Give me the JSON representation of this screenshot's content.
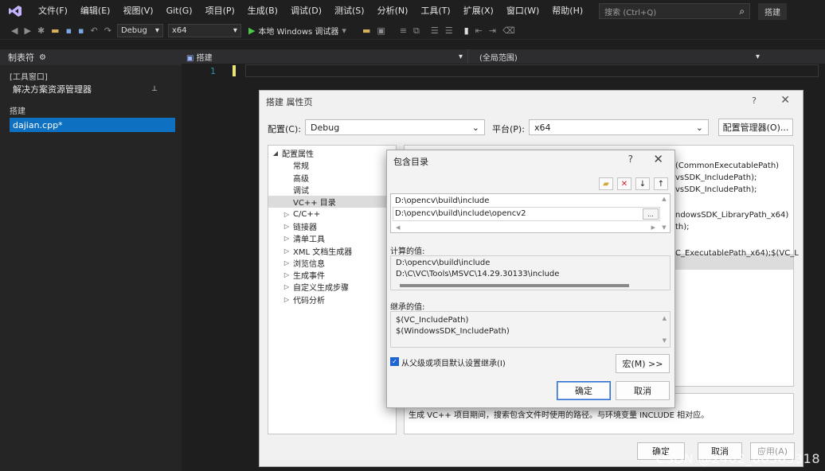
{
  "menubar": {
    "items": [
      "文件(F)",
      "编辑(E)",
      "视图(V)",
      "Git(G)",
      "项目(P)",
      "生成(B)",
      "调试(D)",
      "测试(S)",
      "分析(N)",
      "工具(T)",
      "扩展(X)",
      "窗口(W)",
      "帮助(H)"
    ],
    "search_placeholder": "搜索 (Ctrl+Q)",
    "project_name": "搭建"
  },
  "toolbar": {
    "config": "Debug",
    "platform": "x64",
    "debugger": "本地 Windows 调试器"
  },
  "left_panel": {
    "title": "制表符",
    "section1": "[工具窗口]",
    "solution_explorer": "解决方案资源管理器",
    "section2": "搭建",
    "file": "dajian.cpp*"
  },
  "editor": {
    "tab_file": "搭建",
    "scope": "(全局范围)",
    "line_number": "1"
  },
  "property_dialog": {
    "title": "搭建 属性页",
    "help": "?",
    "config_label": "配置(C):",
    "config_value": "Debug",
    "platform_label": "平台(P):",
    "platform_value": "x64",
    "config_manager": "配置管理器(O)...",
    "tree": [
      {
        "label": "配置属性",
        "expander": "◢",
        "indent": 0
      },
      {
        "label": "常规",
        "expander": "",
        "indent": 1
      },
      {
        "label": "高级",
        "expander": "",
        "indent": 1
      },
      {
        "label": "调试",
        "expander": "",
        "indent": 1
      },
      {
        "label": "VC++ 目录",
        "expander": "",
        "indent": 1,
        "selected": true
      },
      {
        "label": "C/C++",
        "expander": "▷",
        "indent": 1
      },
      {
        "label": "链接器",
        "expander": "▷",
        "indent": 1
      },
      {
        "label": "清单工具",
        "expander": "▷",
        "indent": 1
      },
      {
        "label": "XML 文档生成器",
        "expander": "▷",
        "indent": 1
      },
      {
        "label": "浏览信息",
        "expander": "▷",
        "indent": 1
      },
      {
        "label": "生成事件",
        "expander": "▷",
        "indent": 1
      },
      {
        "label": "自定义生成步骤",
        "expander": "▷",
        "indent": 1
      },
      {
        "label": "代码分析",
        "expander": "▷",
        "indent": 1
      }
    ],
    "grid_values": [
      "(CommonExecutablePath)",
      "vsSDK_IncludePath);",
      "vsSDK_IncludePath);",
      "ndowsSDK_LibraryPath_x64)",
      "th);",
      "C_ExecutablePath_x64);$(VC_L"
    ],
    "description": "生成 VC++ 项目期间，搜索包含文件时使用的路径。与环境变量 INCLUDE 相对应。",
    "ok": "确定",
    "cancel": "取消",
    "apply": "应用(A)"
  },
  "include_dialog": {
    "title": "包含目录",
    "help": "?",
    "entries": [
      "D:\\opencv\\build\\include",
      "D:\\opencv\\build\\include\\opencv2"
    ],
    "computed_label": "计算的值:",
    "computed_values": [
      "D:\\opencv\\build\\include",
      "D:\\C\\VC\\Tools\\MSVC\\14.29.30133\\include"
    ],
    "inherited_label": "继承的值:",
    "inherited_values": [
      "$(VC_IncludePath)",
      "$(WindowsSDK_IncludePath)"
    ],
    "inherit_checkbox": "从父级或项目默认设置继承(I)",
    "inherit_checked": true,
    "macros_button": "宏(M) >>",
    "ok": "确定",
    "cancel": "取消",
    "ellipsis": "..."
  },
  "watermark": "CSDN @2402_86365318"
}
